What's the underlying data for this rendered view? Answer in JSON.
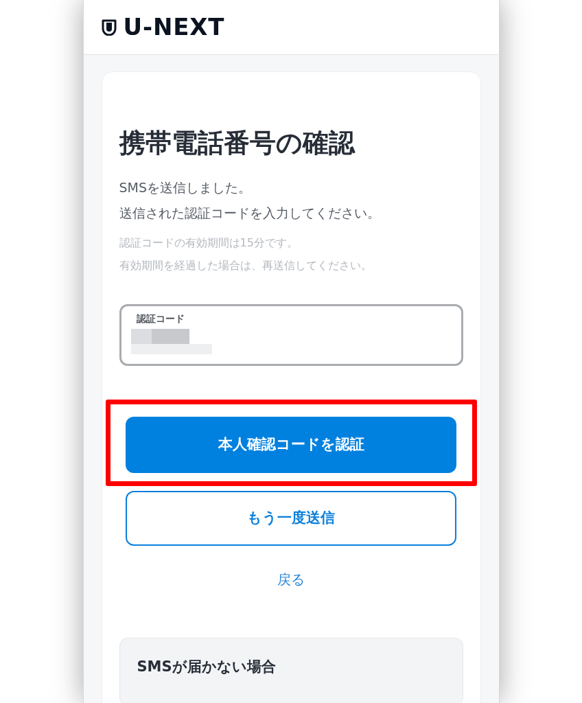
{
  "header": {
    "logo": "U-NEXT"
  },
  "title": "携帯電話番号の確認",
  "message": [
    "SMSを送信しました。",
    "送信された認証コードを入力してください。"
  ],
  "note": [
    "認証コードの有効期間は15分です。",
    "有効期間を経過した場合は、再送信してください。"
  ],
  "code_field": {
    "label": "認証コード",
    "redacted": true
  },
  "buttons": [
    {
      "kind": "primary",
      "label": "本人確認コードを認証",
      "highlighted": true
    },
    {
      "kind": "outline",
      "label": "もう一度送信",
      "highlighted": false
    },
    {
      "kind": "link",
      "label": "戻る",
      "highlighted": false
    }
  ],
  "help_section": {
    "title": "SMSが届かない場合"
  }
}
